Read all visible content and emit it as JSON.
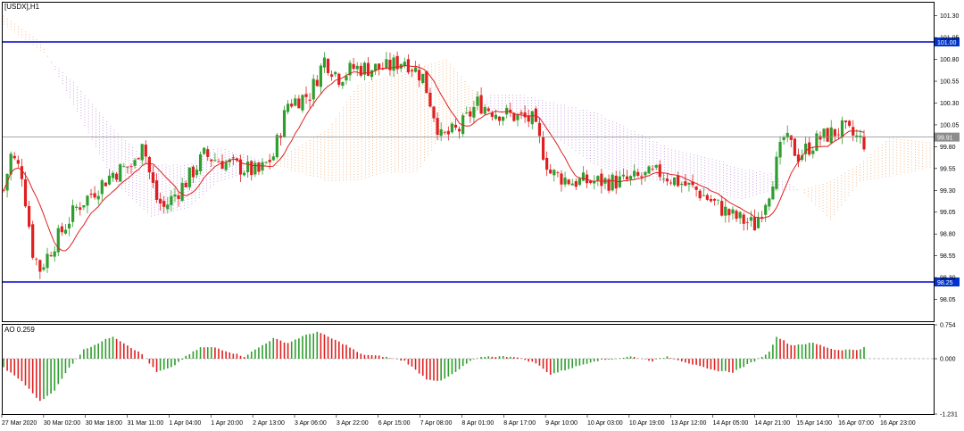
{
  "chart_data": {
    "type": "candlestick",
    "symbol_label": "[USDX],H1",
    "colors": {
      "bull": "#2e9e2e",
      "bear": "#e02020",
      "ma": "#e02020",
      "cloud_bear": "#b37fd6",
      "cloud_bull": "#f0a060",
      "level_line": "#0000cc",
      "badge_blue": "#0033cc",
      "badge_gray": "#8c8c8c",
      "grid": "#000000"
    },
    "price_axis": {
      "range": [
        97.8,
        101.45
      ],
      "ticks": [
        "101.30",
        "101.05",
        "100.80",
        "100.55",
        "100.30",
        "100.05",
        "99.80",
        "99.55",
        "99.30",
        "99.05",
        "98.80",
        "98.55",
        "98.30",
        "98.05"
      ]
    },
    "levels": [
      {
        "value": 101.0,
        "label": "101.00",
        "style": "blue"
      },
      {
        "value": 98.25,
        "label": "98.25",
        "style": "blue"
      },
      {
        "value": 99.91,
        "label": "99.91",
        "style": "gray"
      }
    ],
    "x_labels": [
      "27 Mar 2020",
      "30 Mar 02:00",
      "30 Mar 18:00",
      "31 Mar 11:00",
      "1 Apr 04:00",
      "1 Apr 20:00",
      "2 Apr 13:00",
      "3 Apr 06:00",
      "3 Apr 22:00",
      "6 Apr 15:00",
      "7 Apr 08:00",
      "8 Apr 01:00",
      "8 Apr 17:00",
      "9 Apr 10:00",
      "10 Apr 03:00",
      "10 Apr 19:00",
      "13 Apr 12:00",
      "14 Apr 05:00",
      "14 Apr 21:00",
      "15 Apr 14:00",
      "16 Apr 07:00",
      "16 Apr 23:00"
    ],
    "price_anchors": [
      [
        0,
        99.3
      ],
      [
        2,
        99.7
      ],
      [
        5,
        99.5
      ],
      [
        8,
        98.6
      ],
      [
        10,
        98.4
      ],
      [
        14,
        98.7
      ],
      [
        20,
        99.1
      ],
      [
        30,
        99.5
      ],
      [
        36,
        99.6
      ],
      [
        38,
        99.9
      ],
      [
        40,
        99.5
      ],
      [
        42,
        99.2
      ],
      [
        44,
        99.1
      ],
      [
        50,
        99.4
      ],
      [
        55,
        99.7
      ],
      [
        62,
        99.6
      ],
      [
        70,
        99.5
      ],
      [
        74,
        99.7
      ],
      [
        78,
        100.3
      ],
      [
        84,
        100.4
      ],
      [
        88,
        100.8
      ],
      [
        92,
        100.6
      ],
      [
        96,
        100.7
      ],
      [
        105,
        100.7
      ],
      [
        110,
        100.8
      ],
      [
        115,
        100.6
      ],
      [
        120,
        99.9
      ],
      [
        125,
        100.0
      ],
      [
        130,
        100.3
      ],
      [
        135,
        100.2
      ],
      [
        145,
        100.1
      ],
      [
        150,
        99.5
      ],
      [
        156,
        99.4
      ],
      [
        162,
        99.4
      ],
      [
        170,
        99.4
      ],
      [
        180,
        99.5
      ],
      [
        185,
        99.4
      ],
      [
        190,
        99.3
      ],
      [
        200,
        99.0
      ],
      [
        206,
        98.9
      ],
      [
        210,
        99.3
      ],
      [
        214,
        99.9
      ],
      [
        218,
        99.7
      ],
      [
        224,
        99.9
      ],
      [
        230,
        100.0
      ],
      [
        236,
        99.85
      ]
    ],
    "ao_axis": {
      "range": [
        -1.231,
        0.754
      ],
      "ticks": [
        "0.754",
        "0.000",
        "-1.231"
      ],
      "label": "AO 0.259"
    },
    "ao_anchors": [
      [
        0,
        -0.2
      ],
      [
        5,
        -0.5
      ],
      [
        10,
        -0.95
      ],
      [
        14,
        -0.7
      ],
      [
        18,
        -0.2
      ],
      [
        22,
        0.2
      ],
      [
        26,
        0.35
      ],
      [
        30,
        0.5
      ],
      [
        34,
        0.3
      ],
      [
        38,
        0.1
      ],
      [
        42,
        -0.3
      ],
      [
        46,
        -0.2
      ],
      [
        50,
        0.05
      ],
      [
        54,
        0.25
      ],
      [
        58,
        0.25
      ],
      [
        62,
        0.15
      ],
      [
        66,
        0.05
      ],
      [
        70,
        0.25
      ],
      [
        74,
        0.45
      ],
      [
        78,
        0.35
      ],
      [
        82,
        0.5
      ],
      [
        86,
        0.6
      ],
      [
        90,
        0.45
      ],
      [
        94,
        0.3
      ],
      [
        98,
        0.1
      ],
      [
        104,
        0.05
      ],
      [
        110,
        -0.05
      ],
      [
        116,
        -0.45
      ],
      [
        120,
        -0.5
      ],
      [
        124,
        -0.3
      ],
      [
        128,
        -0.05
      ],
      [
        132,
        0.05
      ],
      [
        140,
        0.05
      ],
      [
        146,
        -0.1
      ],
      [
        150,
        -0.35
      ],
      [
        156,
        -0.2
      ],
      [
        162,
        -0.05
      ],
      [
        168,
        0.0
      ],
      [
        172,
        0.05
      ],
      [
        178,
        -0.05
      ],
      [
        182,
        0.05
      ],
      [
        188,
        -0.1
      ],
      [
        194,
        -0.25
      ],
      [
        200,
        -0.3
      ],
      [
        206,
        -0.05
      ],
      [
        210,
        0.15
      ],
      [
        212,
        0.5
      ],
      [
        216,
        0.3
      ],
      [
        222,
        0.35
      ],
      [
        228,
        0.2
      ],
      [
        234,
        0.2
      ],
      [
        236,
        0.25
      ]
    ],
    "cloud": {
      "a_anchors": [
        [
          0,
          101.3
        ],
        [
          10,
          101.0
        ],
        [
          20,
          100.2
        ],
        [
          30,
          99.4
        ],
        [
          40,
          99.0
        ],
        [
          50,
          99.1
        ],
        [
          58,
          99.4
        ],
        [
          66,
          99.5
        ],
        [
          72,
          99.6
        ],
        [
          80,
          99.8
        ],
        [
          88,
          100.0
        ],
        [
          96,
          100.5
        ],
        [
          104,
          100.6
        ],
        [
          112,
          100.7
        ],
        [
          120,
          100.8
        ],
        [
          128,
          100.4
        ],
        [
          132,
          100.2
        ],
        [
          140,
          100.2
        ],
        [
          150,
          99.9
        ],
        [
          160,
          99.6
        ],
        [
          170,
          99.45
        ],
        [
          180,
          99.4
        ],
        [
          190,
          99.3
        ],
        [
          200,
          99.2
        ],
        [
          208,
          99.3
        ],
        [
          216,
          99.3
        ],
        [
          224,
          99.4
        ],
        [
          232,
          99.6
        ],
        [
          240,
          99.9
        ],
        [
          250,
          99.85
        ]
      ],
      "b_anchors": [
        [
          0,
          101.2
        ],
        [
          10,
          100.9
        ],
        [
          20,
          100.5
        ],
        [
          30,
          100.0
        ],
        [
          40,
          99.6
        ],
        [
          50,
          99.6
        ],
        [
          58,
          99.8
        ],
        [
          66,
          99.7
        ],
        [
          72,
          99.6
        ],
        [
          80,
          99.5
        ],
        [
          88,
          99.4
        ],
        [
          96,
          99.4
        ],
        [
          104,
          99.5
        ],
        [
          112,
          99.5
        ],
        [
          120,
          100.0
        ],
        [
          128,
          100.2
        ],
        [
          132,
          100.4
        ],
        [
          140,
          100.4
        ],
        [
          150,
          100.3
        ],
        [
          160,
          100.2
        ],
        [
          170,
          100.0
        ],
        [
          180,
          99.8
        ],
        [
          190,
          99.7
        ],
        [
          200,
          99.55
        ],
        [
          208,
          99.5
        ],
        [
          216,
          99.3
        ],
        [
          224,
          98.95
        ],
        [
          232,
          99.4
        ],
        [
          240,
          99.45
        ],
        [
          250,
          99.55
        ]
      ]
    }
  }
}
